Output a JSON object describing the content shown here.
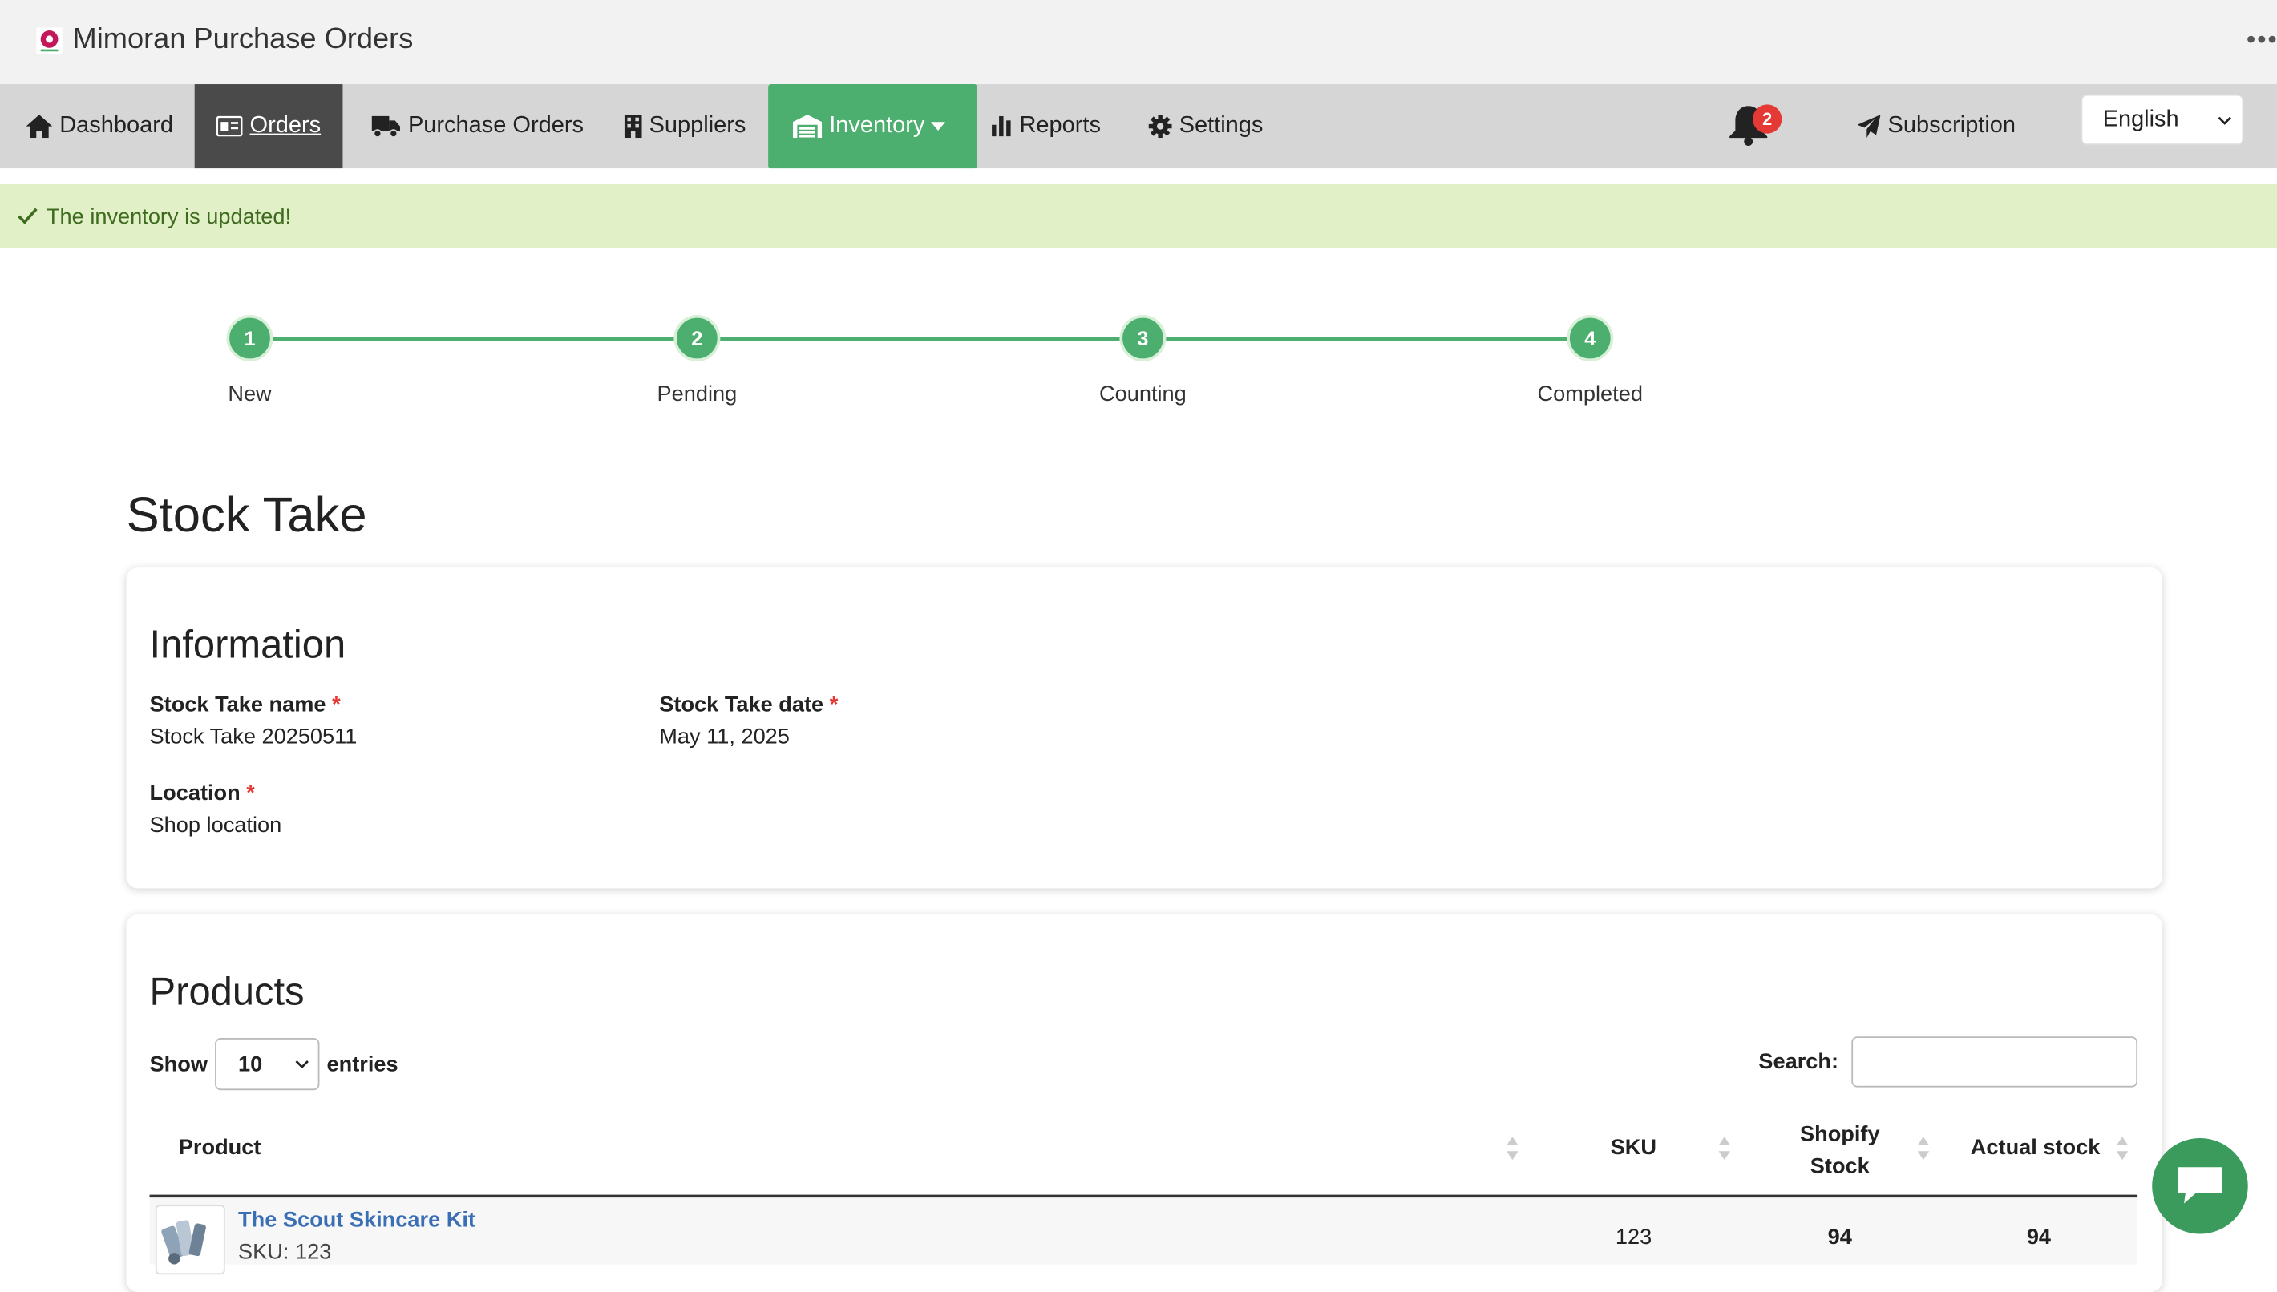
{
  "app": {
    "title": "Mimoran Purchase Orders",
    "more_icon": "ellipsis-icon"
  },
  "nav": {
    "items": [
      {
        "label": "Dashboard",
        "icon": "home-icon"
      },
      {
        "label": "Orders",
        "icon": "id-card-icon"
      },
      {
        "label": "Purchase Orders",
        "icon": "truck-icon"
      },
      {
        "label": "Suppliers",
        "icon": "building-icon"
      },
      {
        "label": "Inventory",
        "icon": "warehouse-icon"
      },
      {
        "label": "Reports",
        "icon": "bar-chart-icon"
      },
      {
        "label": "Settings",
        "icon": "gear-icon"
      }
    ],
    "notifications_count": "2",
    "subscription_label": "Subscription",
    "language": "English"
  },
  "alert": {
    "message": "The inventory is updated!"
  },
  "steps": [
    {
      "number": "1",
      "label": "New"
    },
    {
      "number": "2",
      "label": "Pending"
    },
    {
      "number": "3",
      "label": "Counting"
    },
    {
      "number": "4",
      "label": "Completed"
    }
  ],
  "page_title": "Stock Take",
  "information": {
    "heading": "Information",
    "name_label": "Stock Take name",
    "name_value": "Stock Take 20250511",
    "date_label": "Stock Take date",
    "date_value": "May 11, 2025",
    "location_label": "Location",
    "location_value": "Shop location",
    "required_mark": "*"
  },
  "products": {
    "heading": "Products",
    "show_label": "Show",
    "entries_value": "10",
    "entries_label": "entries",
    "search_label": "Search:",
    "search_value": "",
    "columns": [
      "Product",
      "SKU",
      "Shopify Stock",
      "Actual stock"
    ],
    "rows": [
      {
        "product": "The Scout Skincare Kit",
        "sku_line": "SKU: 123",
        "sku": "123",
        "shopify_stock": "94",
        "actual_stock": "94"
      }
    ]
  },
  "colors": {
    "accent_green": "#4caf6f",
    "nav_active_dark": "#4a4a4a",
    "alert_bg": "#e1f0c6",
    "link_blue": "#3b6fb5",
    "badge_red": "#e53935"
  }
}
